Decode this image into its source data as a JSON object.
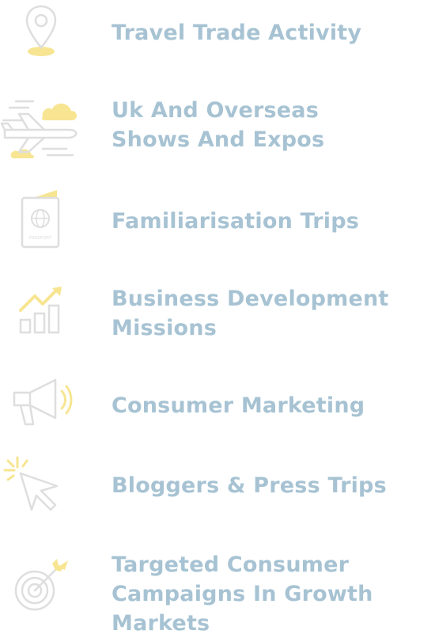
{
  "colors": {
    "heading": "#a7c3d3",
    "icon_outline": "#dedede",
    "icon_accent": "#f7e592"
  },
  "items": [
    {
      "label": "Travel Trade Activity",
      "icon": "location-pin-icon"
    },
    {
      "label": "Uk And Overseas\nShows And Expos",
      "icon": "airplane-cloud-icon"
    },
    {
      "label": "Familiarisation Trips",
      "icon": "passport-icon",
      "icon_text": "PASSPORT"
    },
    {
      "label": "Business Development\nMissions",
      "icon": "growth-chart-icon"
    },
    {
      "label": "Consumer Marketing",
      "icon": "megaphone-icon"
    },
    {
      "label": "Bloggers & Press Trips",
      "icon": "cursor-click-icon"
    },
    {
      "label": "Targeted Consumer\nCampaigns In Growth\nMarkets",
      "icon": "target-icon"
    }
  ]
}
